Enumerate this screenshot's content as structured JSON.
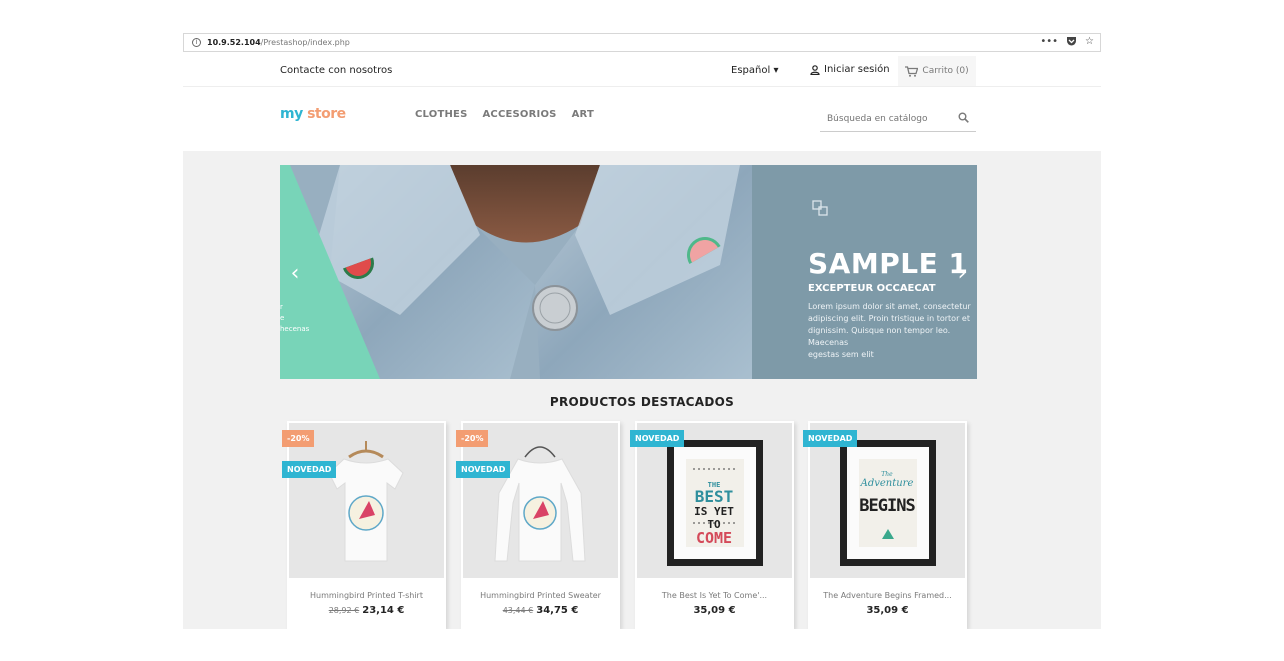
{
  "browser": {
    "url_host": "10.9.52.104",
    "url_path": "/Prestashop/index.php",
    "more_glyph": "•••",
    "star_glyph": "☆"
  },
  "nav": {
    "contact": "Contacte con nosotros",
    "language": "Español",
    "sign_in": "Iniciar sesión",
    "cart": "Carrito (0)"
  },
  "header": {
    "logo_first": "my",
    "logo_second": "store",
    "menu": [
      "CLOTHES",
      "ACCESORIOS",
      "ART"
    ],
    "search_placeholder": "Búsqueda en catálogo"
  },
  "carousel": {
    "title": "SAMPLE 1",
    "subtitle": "EXCEPTEUR OCCAECAT",
    "description": "Lorem ipsum dolor sit amet, consectetur\nadipiscing elit. Proin tristique in tortor et\ndignissim. Quisque non tempor leo. Maecenas\negestas sem elit",
    "left_fragment": "r\ne\nhecenas",
    "prev_glyph": "‹",
    "next_glyph": "›"
  },
  "featured": {
    "title": "PRODUCTOS DESTACADOS"
  },
  "products": [
    {
      "name": "Hummingbird Printed T-shirt",
      "discount": "-20%",
      "flag": "NOVEDAD",
      "old_price": "28,92 €",
      "price": "23,14 €"
    },
    {
      "name": "Hummingbird Printed Sweater",
      "discount": "-20%",
      "flag": "NOVEDAD",
      "old_price": "43,44 €",
      "price": "34,75 €"
    },
    {
      "name": "The Best Is Yet To Come'...",
      "flag": "NOVEDAD",
      "price": "35,09 €",
      "poster": [
        "THE",
        "BEST",
        "IS YET TO",
        "COME"
      ]
    },
    {
      "name": "The Adventure Begins Framed...",
      "flag": "NOVEDAD",
      "price": "35,09 €",
      "poster": [
        "The",
        "Adventure",
        "BEGINS"
      ]
    }
  ],
  "colors": {
    "accent": "#2fb5d2",
    "discount": "#f39d72",
    "slide_panel": "#7e9aa8",
    "slide_accent": "#78d4b8"
  }
}
